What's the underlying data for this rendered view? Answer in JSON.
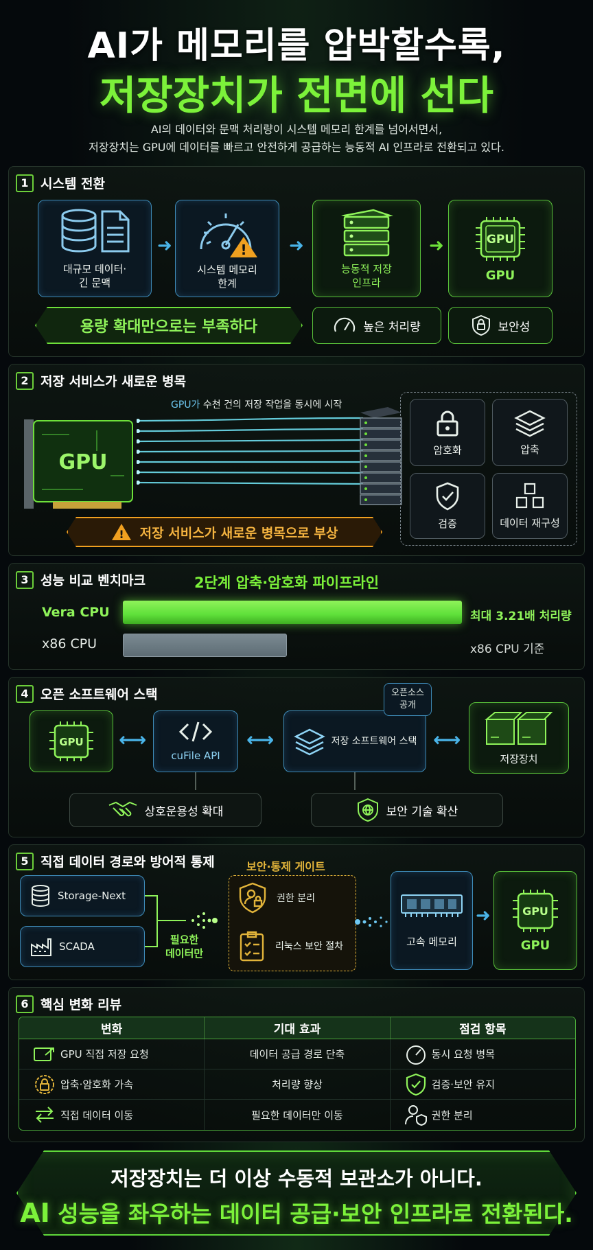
{
  "header": {
    "title_line1": "AI가 메모리를 압박할수록,",
    "title_line2": "저장장치가 전면에 선다",
    "subtitle_line1": "AI의 데이터와 문맥 처리량이 시스템 메모리 한계를 넘어서면서,",
    "subtitle_line2": "저장장치는 GPU에 데이터를 빠르고 안전하게 공급하는 능동적 AI 인프라로 전환되고 있다."
  },
  "section1": {
    "number": "1",
    "title": "시스템 전환",
    "steps": [
      {
        "label_line1": "대규모 데이터·",
        "label_line2": "긴 문맥",
        "icon": "database-document-icon"
      },
      {
        "label_line1": "시스템 메모리",
        "label_line2": "한계",
        "icon": "gauge-warning-icon"
      },
      {
        "label_line1": "능동적 저장",
        "label_line2": "인프라",
        "icon": "server-stack-icon"
      },
      {
        "label_line1": "GPU",
        "label_line2": "GPU",
        "icon": "gpu-chip-icon"
      }
    ],
    "banner": "용량 확대만으로는 부족하다",
    "badges": [
      "높은 처리량",
      "보안성"
    ]
  },
  "section2": {
    "number": "2",
    "title": "저장 서비스가 새로운 병목",
    "gpu_card_label": "GPU",
    "flow_caption_highlight": "GPU가",
    "flow_caption_rest": " 수천 건의 저장 작업을 동시에 시작",
    "services": [
      "암호화",
      "압축",
      "검증",
      "데이터 재구성"
    ],
    "warning": "저장 서비스가 새로운 병목으로 부상"
  },
  "section3": {
    "number": "3",
    "title": "성능 비교 벤치마크",
    "pipeline_title": "2단계 압축·암호화 파이프라인",
    "bars": [
      {
        "name": "Vera CPU",
        "value": 3.21,
        "note": "최대 3.21배 처리량",
        "color": "#5ee03a"
      },
      {
        "name": "x86 CPU",
        "value": 1.0,
        "note": "x86 CPU 기준",
        "color": "#5d6c74"
      }
    ]
  },
  "section4": {
    "number": "4",
    "title": "오픈 소프트웨어 스택",
    "nodes": [
      "GPU",
      "cuFile API",
      "저장 소프트웨어 스택",
      "저장장치"
    ],
    "open_source_tag_line1": "오픈소스",
    "open_source_tag_line2": "공개",
    "benefits": [
      "상호운용성 확대",
      "보안 기술 확산"
    ]
  },
  "section5": {
    "number": "5",
    "title": "직접 데이터 경로와 방어적 통제",
    "sources": [
      "Storage-Next",
      "SCADA"
    ],
    "filter_line1": "필요한",
    "filter_line2": "데이터만",
    "gate_title": "보안·통제 게이트",
    "gate_items": [
      "권한 분리",
      "리눅스 보안 절차"
    ],
    "memory_label": "고속 메모리",
    "gpu_label": "GPU",
    "gpu_chip": "GPU"
  },
  "section6": {
    "number": "6",
    "title": "핵심 변화 리뷰",
    "columns": [
      "변화",
      "기대 효과",
      "점검 항목"
    ],
    "rows": [
      {
        "change": "GPU 직접 저장 요청",
        "effect": "데이터 공급 경로 단축",
        "check": "동시 요청 병목",
        "icon1": "gpu-request-icon",
        "icon2": "gauge-icon"
      },
      {
        "change": "압축·암호화 가속",
        "effect": "처리량 향상",
        "check": "검증·보안 유지",
        "icon1": "lock-cog-icon",
        "icon2": "shield-check-icon"
      },
      {
        "change": "직접 데이터 이동",
        "effect": "필요한 데이터만 이동",
        "check": "권한 분리",
        "icon1": "transfer-arrows-icon",
        "icon2": "user-shield-icon"
      }
    ]
  },
  "footer": {
    "line1": "저장장치는 더 이상 수동적 보관소가 아니다.",
    "line2_highlight": "AI",
    "line2_rest": " 성능을 좌우하는 데이터 공급·보안 인프라로 전환된다."
  },
  "colors": {
    "accent_green": "#7cf23a",
    "accent_blue": "#4ab4e8",
    "warning_orange": "#f0a020",
    "gate_yellow": "#e2b43a"
  }
}
